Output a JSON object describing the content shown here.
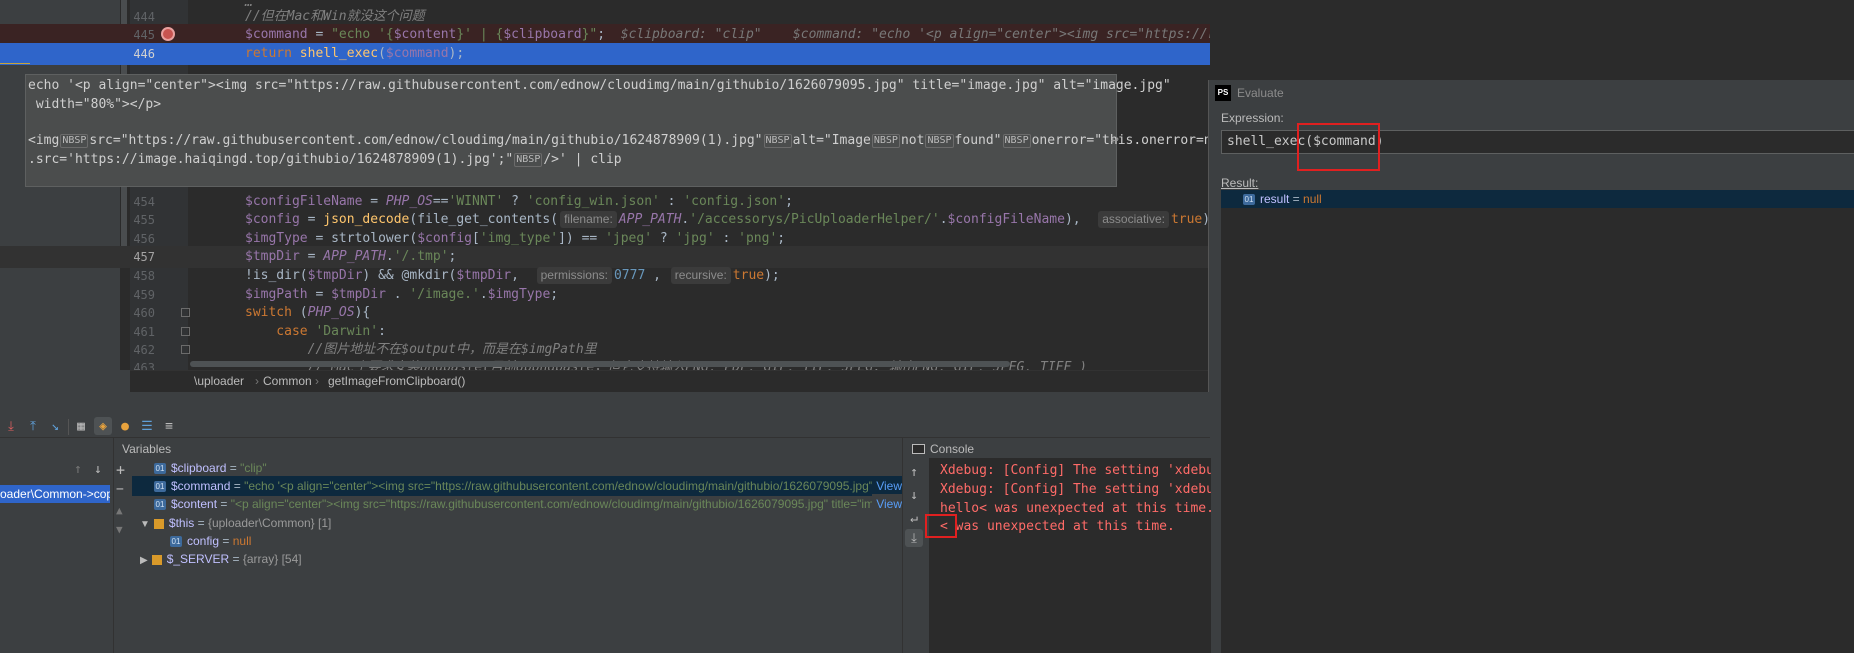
{
  "editor": {
    "lines": [
      {
        "num": "",
        "segs": [
          {
            "c": "cmt",
            "t": "…"
          }
        ]
      },
      {
        "num": "444",
        "segs": [
          {
            "c": "cmt",
            "t": "//但在Mac和Win就没这个问题"
          }
        ]
      },
      {
        "num": "445",
        "segs": [
          {
            "c": "var",
            "t": "$command"
          },
          {
            "c": "",
            "t": " = "
          },
          {
            "c": "str",
            "t": "\"echo '{"
          },
          {
            "c": "var",
            "t": "$content"
          },
          {
            "c": "str",
            "t": "}' | {"
          },
          {
            "c": "var",
            "t": "$clipboard"
          },
          {
            "c": "str",
            "t": "}\""
          },
          {
            "c": "",
            "t": ";  "
          },
          {
            "c": "hint",
            "t": "$clipboard: \"clip\"    $command: \"echo '<p align=\"center\"><img src=\"https://raw.githubusercontent.com/ednow/cloudimg/main/githubio/1626079095.jpg\" ti"
          }
        ]
      },
      {
        "num": "446",
        "segs": [
          {
            "c": "kw",
            "t": "return "
          },
          {
            "c": "fn",
            "t": "shell_exec"
          },
          {
            "c": "",
            "t": "("
          },
          {
            "c": "var",
            "t": "$command"
          },
          {
            "c": "",
            "t": ");"
          }
        ]
      },
      {
        "num": "454",
        "segs": [
          {
            "c": "var",
            "t": "$configFileName"
          },
          {
            "c": "",
            "t": " = "
          },
          {
            "c": "cst",
            "t": "PHP_OS"
          },
          {
            "c": "",
            "t": "=="
          },
          {
            "c": "str",
            "t": "'WINNT'"
          },
          {
            "c": "",
            "t": " ? "
          },
          {
            "c": "str",
            "t": "'config_win.json'"
          },
          {
            "c": "",
            "t": " : "
          },
          {
            "c": "str",
            "t": "'config.json'"
          },
          {
            "c": "",
            "t": ";"
          }
        ]
      },
      {
        "num": "455",
        "segs": [
          {
            "c": "var",
            "t": "$config"
          },
          {
            "c": "",
            "t": " = "
          },
          {
            "c": "fn",
            "t": "json_decode"
          },
          {
            "c": "",
            "t": "(file_get_contents("
          },
          {
            "c": "hb",
            "t": "filename:"
          },
          {
            "c": "cst",
            "t": "APP_PATH"
          },
          {
            "c": "",
            "t": "."
          },
          {
            "c": "str",
            "t": "'/accessorys/PicUploaderHelper/'"
          },
          {
            "c": "",
            "t": "."
          },
          {
            "c": "var",
            "t": "$configFileName"
          },
          {
            "c": "",
            "t": "),  "
          },
          {
            "c": "hb",
            "t": "associative:"
          },
          {
            "c": "kw",
            "t": "true"
          },
          {
            "c": "",
            "t": ");"
          }
        ]
      },
      {
        "num": "456",
        "segs": [
          {
            "c": "var",
            "t": "$imgType"
          },
          {
            "c": "",
            "t": " = strtolower("
          },
          {
            "c": "var",
            "t": "$config"
          },
          {
            "c": "",
            "t": "["
          },
          {
            "c": "str",
            "t": "'img_type'"
          },
          {
            "c": "",
            "t": "]) == "
          },
          {
            "c": "str",
            "t": "'jpeg'"
          },
          {
            "c": "",
            "t": " ? "
          },
          {
            "c": "str",
            "t": "'jpg'"
          },
          {
            "c": "",
            "t": " : "
          },
          {
            "c": "str",
            "t": "'png'"
          },
          {
            "c": "",
            "t": ";"
          }
        ]
      },
      {
        "num": "457",
        "segs": [
          {
            "c": "var",
            "t": "$tmpDir"
          },
          {
            "c": "",
            "t": " = "
          },
          {
            "c": "cst",
            "t": "APP_PATH"
          },
          {
            "c": "",
            "t": "."
          },
          {
            "c": "str",
            "t": "'/.tmp'"
          },
          {
            "c": "",
            "t": ";"
          }
        ]
      },
      {
        "num": "458",
        "segs": [
          {
            "c": "",
            "t": "!is_dir("
          },
          {
            "c": "var",
            "t": "$tmpDir"
          },
          {
            "c": "",
            "t": ") && @mkdir("
          },
          {
            "c": "var",
            "t": "$tmpDir"
          },
          {
            "c": "",
            "t": ",  "
          },
          {
            "c": "hb",
            "t": "permissions:"
          },
          {
            "c": "num",
            "t": "0777"
          },
          {
            "c": "",
            "t": " , "
          },
          {
            "c": "hb",
            "t": "recursive:"
          },
          {
            "c": "kw",
            "t": "true"
          },
          {
            "c": "",
            "t": ");"
          }
        ]
      },
      {
        "num": "459",
        "segs": [
          {
            "c": "var",
            "t": "$imgPath"
          },
          {
            "c": "",
            "t": " = "
          },
          {
            "c": "var",
            "t": "$tmpDir"
          },
          {
            "c": "",
            "t": " . "
          },
          {
            "c": "str",
            "t": "'/image.'"
          },
          {
            "c": "",
            "t": "."
          },
          {
            "c": "var",
            "t": "$imgType"
          },
          {
            "c": "",
            "t": ";"
          }
        ]
      },
      {
        "num": "460",
        "segs": [
          {
            "c": "kw",
            "t": "switch "
          },
          {
            "c": "",
            "t": "("
          },
          {
            "c": "cst",
            "t": "PHP_OS"
          },
          {
            "c": "",
            "t": "){"
          }
        ]
      },
      {
        "num": "461",
        "segs": [
          {
            "c": "kw",
            "t": "    case "
          },
          {
            "c": "str",
            "t": "'Darwin'"
          },
          {
            "c": "",
            "t": ":"
          }
        ]
      },
      {
        "num": "462",
        "segs": [
          {
            "c": "cmt",
            "t": "        //图片地址不在$output中，而是在$imgPath里"
          }
        ]
      },
      {
        "num": "463",
        "segs": [
          {
            "c": "cmt",
            "t": "        // Mac上要求安装pngpaste(目前Uppngpaste，但它支持输入PNG, PDF, GIF, TIF, JPEG; 输出PNG, GIF, JPEG, TIFF )"
          }
        ]
      }
    ],
    "tooltip": {
      "line1": "echo '<p align=\"center\"><img src=\"https://raw.githubusercontent.com/ednow/cloudimg/main/githubio/1626079095.jpg\" title=\"image.jpg\" alt=\"image.jpg\"",
      "line2": " width=\"80%\"></p>",
      "line3_parts": [
        "<img",
        "NBSP",
        "src=\"https://raw.githubusercontent.com/ednow/cloudimg/main/githubio/1624878909(1).jpg\"",
        "NBSP",
        "alt=\"Image",
        "NBSP",
        "not",
        "NBSP",
        "found\"",
        "NBSP",
        "onerror=\"this.onerror=null;this."
      ],
      "line4_parts": [
        ".src='https://image.haiqingd.top/githubio/1624878909(1).jpg';\"",
        "NBSP",
        "/>' | clip"
      ]
    },
    "breadcrumb": [
      "\\uploader",
      "Common",
      "getImageFromClipboard()"
    ]
  },
  "evaluate": {
    "title": "Evaluate",
    "logo": "PS",
    "expression_label": "Expression:",
    "expression_value": "shell_exec($command)",
    "result_label": "Result:",
    "result_name": "result",
    "result_eq": " = ",
    "result_value": "null"
  },
  "variables": {
    "title": "Variables",
    "frame_label": "oader\\Common->copy",
    "items": [
      {
        "name": "$clipboard",
        "eq": " = ",
        "value": "\"clip\"",
        "more": ""
      },
      {
        "name": "$command",
        "eq": " = ",
        "value": "\"echo '<p align=\"center\"><img src=\"https://raw.githubusercontent.com/ednow/cloudimg/main/githubio/1626079095.jpg\" title=...",
        "more": "View"
      },
      {
        "name": "$content",
        "eq": " = ",
        "value": "\"<p align=\"center\"><img src=\"https://raw.githubusercontent.com/ednow/cloudimg/main/githubio/1626079095.jpg\" title=\"image.jp...",
        "more": "View"
      },
      {
        "name": "$this",
        "eq": " = ",
        "value": "{uploader\\Common} [1]",
        "more": ""
      },
      {
        "name": "config",
        "eq": " = ",
        "value": "null",
        "more": ""
      },
      {
        "name": "$_SERVER",
        "eq": " = ",
        "value": "{array} [54]",
        "more": ""
      }
    ]
  },
  "console": {
    "title": "Console",
    "lines": [
      "Xdebug: [Config] The setting 'xdebug.rem",
      "Xdebug: [Config] The setting 'xdebug.rem",
      "hello< was unexpected at this time.",
      "< was unexpected at this time."
    ]
  },
  "colors": {
    "highlight_box": "#e02020",
    "selection": "#2f65ca",
    "breakpoint_line": "#3a2323"
  }
}
